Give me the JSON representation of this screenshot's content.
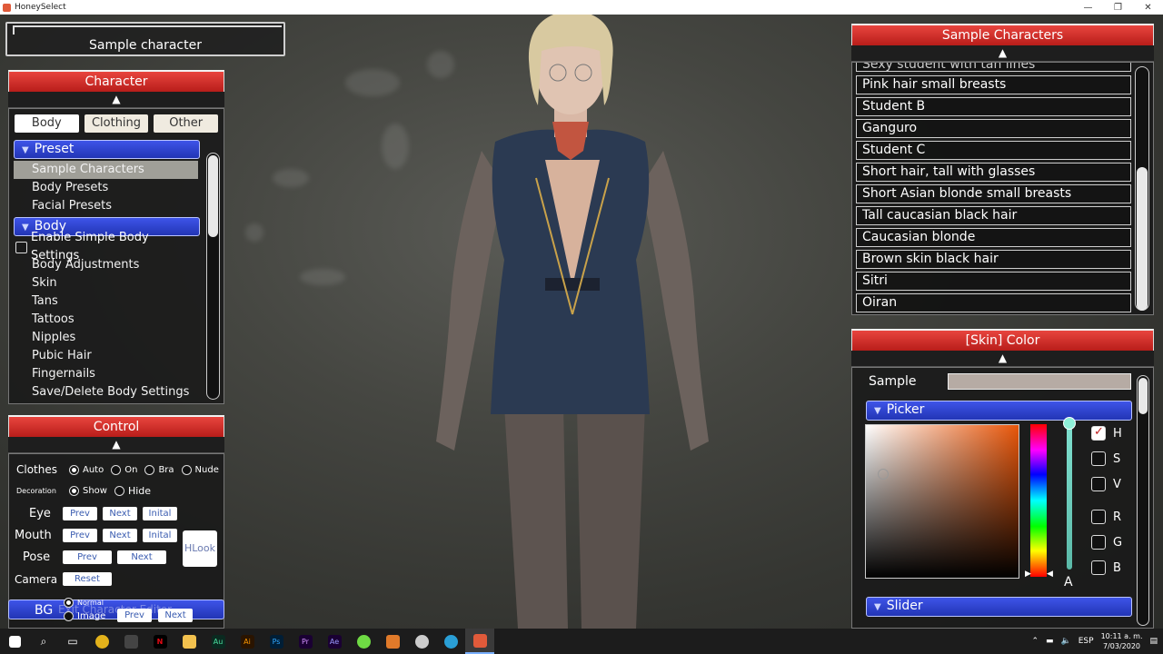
{
  "window": {
    "title": "HoneySelect",
    "controls": [
      "—",
      "❐",
      "✕"
    ]
  },
  "scene": {
    "title_box": "Sample character"
  },
  "character_panel": {
    "header": "Character",
    "collapse_arrow": "▲",
    "tabs": [
      {
        "label": "Body",
        "active": true
      },
      {
        "label": "Clothing",
        "active": false
      },
      {
        "label": "Other",
        "active": false
      }
    ],
    "preset_group": "Preset",
    "preset_items": [
      "Sample Characters",
      "Body Presets",
      "Facial Presets"
    ],
    "body_group": "Body",
    "enable_simple": "Enable Simple Body Settings",
    "body_items": [
      "Body Adjustments",
      "Skin",
      "Tans",
      "Tattoos",
      "Nipples",
      "Pubic Hair",
      "Fingernails",
      "Save/Delete Body Settings"
    ]
  },
  "control_panel": {
    "header": "Control",
    "collapse_arrow": "▲",
    "clothes_label": "Clothes",
    "clothes_options": [
      "Auto",
      "On",
      "Bra",
      "Nude"
    ],
    "decoration_label": "Decoration",
    "decoration_options": [
      "Show",
      "Hide"
    ],
    "eye_label": "Eye",
    "mouth_label": "Mouth",
    "pose_label": "Pose",
    "camera_label": "Camera",
    "prev": "Prev",
    "next": "Next",
    "inital": "Inital",
    "reset": "Reset",
    "hlook": "HLook",
    "bg_label": "BG",
    "bg_options": [
      "Normal",
      "Image"
    ],
    "exit_hint": "Exit Character Editor"
  },
  "sample_panel": {
    "header": "Sample Characters",
    "collapse_arrow": "▲",
    "cut_item": "Sexy student with tan lines",
    "items": [
      "Pink hair small breasts",
      "Student B",
      "Ganguro",
      "Student C",
      "Short hair, tall with glasses",
      "Short Asian blonde small breasts",
      "Tall caucasian black hair",
      "Caucasian blonde",
      "Brown skin black hair",
      "Sitri",
      "Oiran"
    ]
  },
  "skin_panel": {
    "header": "[Skin] Color",
    "collapse_arrow": "▲",
    "sample_label": "Sample",
    "sample_color": "#b6aba4",
    "picker_label": "Picker",
    "slider_label": "Slider",
    "alpha_label": "A",
    "channels": [
      {
        "label": "H",
        "checked": true
      },
      {
        "label": "S",
        "checked": false
      },
      {
        "label": "V",
        "checked": false
      },
      {
        "label": "R",
        "checked": false
      },
      {
        "label": "G",
        "checked": false
      },
      {
        "label": "B",
        "checked": false
      }
    ]
  },
  "taskbar": {
    "icons": [
      "windows-start-icon",
      "search-icon",
      "task-view-icon",
      "chrome-icon",
      "app-icon",
      "netflix-icon",
      "files-icon",
      "audition-icon",
      "illustrator-icon",
      "photoshop-icon",
      "premiere-icon",
      "aftereffects-icon",
      "upwork-icon",
      "app2-icon",
      "app3-icon",
      "edge-icon",
      "honeyselect-icon"
    ],
    "lang": "ESP",
    "time": "10:11 a. m.",
    "date": "7/03/2020"
  },
  "colors": {
    "panel_header_red": "#d0302b",
    "group_blue": "#2f45d0",
    "hue_accent": "#e8560a"
  }
}
